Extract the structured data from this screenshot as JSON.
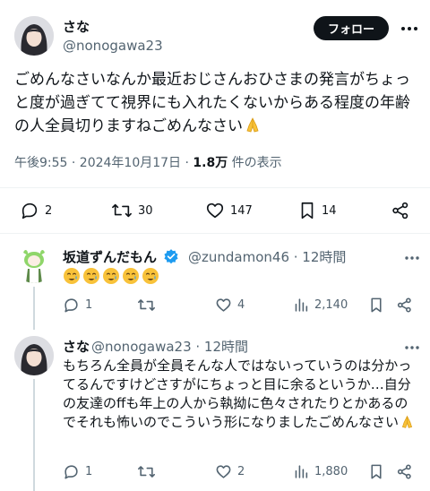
{
  "main_tweet": {
    "name": "さな",
    "handle": "@nonogawa23",
    "follow_label": "フォロー",
    "text": "ごめんなさいなんか最近おじさんおひさまの発言がちょっと度が過ぎてて視界にも入れたくないからある程度の年齢の人全員切りますねごめんなさい",
    "time": "午後9:55 · 2024年10月17日 · ",
    "views": "1.8万",
    "views_suffix": " 件の表示",
    "replies": "2",
    "retweets": "30",
    "likes": "147",
    "bookmarks": "14"
  },
  "replies": [
    {
      "name": "坂道ずんだもん",
      "handle": "@zundamon46 · 12時間",
      "emoji_count": 5,
      "replies": "1",
      "likes": "4",
      "views": "2,140"
    },
    {
      "name": "さな",
      "handle": "@nonogawa23 · 12時間",
      "text": "もちろん全員が全員そんな人ではないっていうのは分かってるんですけどさすがにちょっと目に余るというか…自分の友達のffも年上の人から執拗に色々されたりとかあるのでそれも怖いのでこういう形になりましたごめんなさい",
      "replies": "1",
      "likes": "2",
      "views": "1,880"
    }
  ],
  "colors": {
    "text": "#0f1419",
    "secondary": "#536471",
    "verified": "#1d9bf0",
    "divider": "#eff3f4"
  }
}
